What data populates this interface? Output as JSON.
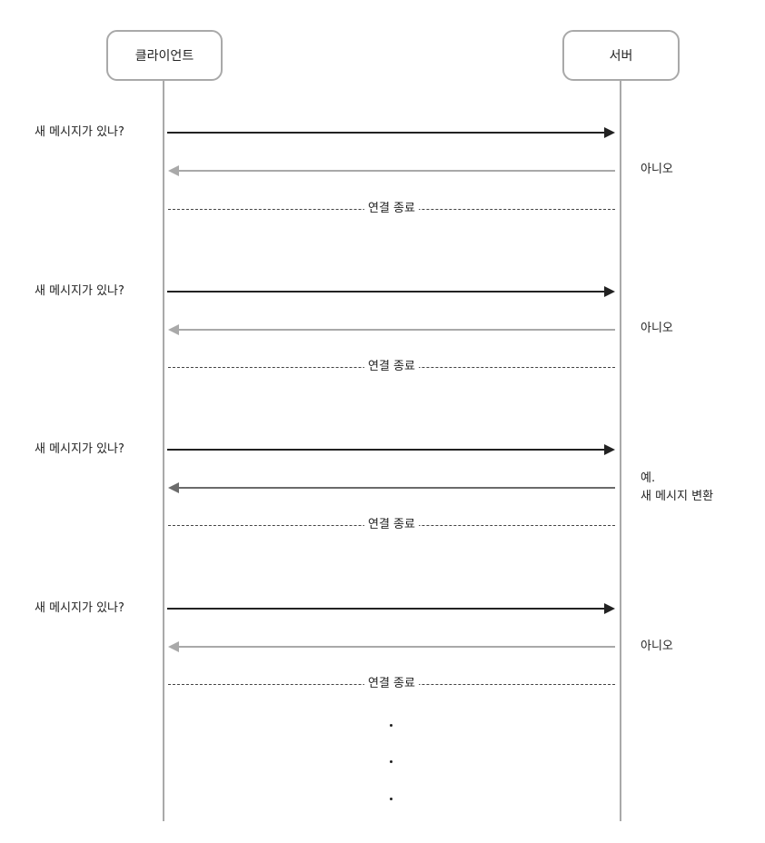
{
  "participants": {
    "client": "클라이언트",
    "server": "서버"
  },
  "exchanges": [
    {
      "request": "새 메시지가 있나?",
      "response_line1": "아니오",
      "response_line2": "",
      "close": "연결 종료"
    },
    {
      "request": "새 메시지가 있나?",
      "response_line1": "아니오",
      "response_line2": "",
      "close": "연결 종료"
    },
    {
      "request": "새 메시지가 있나?",
      "response_line1": "예.",
      "response_line2": "새 메시지 변환",
      "close": "연결 종료"
    },
    {
      "request": "새 메시지가 있나?",
      "response_line1": "아니오",
      "response_line2": "",
      "close": "연결 종료"
    }
  ],
  "colors": {
    "request_arrow": "#222222",
    "empty_response_arrow": "#a9a9a9",
    "message_response_arrow": "#6b6b6b",
    "lifeline": "#a9a9a9"
  },
  "continuation": "vertical-ellipsis"
}
